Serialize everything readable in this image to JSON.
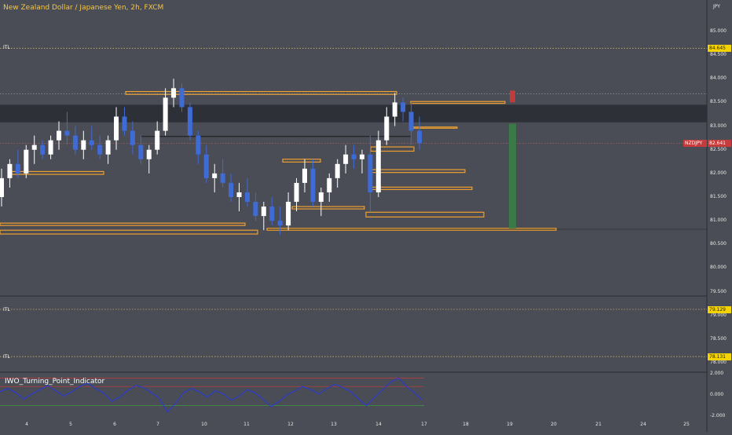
{
  "header": {
    "title": "New Zealand Dollar / Japanese Yen, 2h, FXCM",
    "currency": "JPY",
    "symbol": "NZDJPY"
  },
  "price_axis": {
    "labels": [
      "85.000",
      "84.500",
      "84.000",
      "83.500",
      "83.000",
      "82.500",
      "82.000",
      "81.500",
      "81.000",
      "80.500",
      "80.000",
      "79.500",
      "79.000",
      "78.500",
      "78.000"
    ],
    "current_price": "82.641",
    "itl_levels": [
      {
        "label": "ITL",
        "value": "84.645"
      },
      {
        "label": "ITL",
        "value": "79.129"
      },
      {
        "label": "ITL",
        "value": "78.131"
      }
    ]
  },
  "indicator": {
    "name": "IWO_Turning_Point_Indicator",
    "axis_labels": [
      "2.000",
      "0.000",
      "-2.000"
    ]
  },
  "time_axis": {
    "labels": [
      "4",
      "5",
      "6",
      "7",
      "10",
      "11",
      "12",
      "13",
      "14",
      "17",
      "18",
      "19",
      "20",
      "21",
      "24",
      "25"
    ]
  },
  "colors": {
    "background": "#4a4d55",
    "zone": "#f0a030",
    "up_candle": "#ffffff",
    "down_candle": "#3f6bd6",
    "itl_line": "#d9c36a",
    "sell_marker": "#c23a3a",
    "target_bar": "#3a7a46",
    "band_dark": "#2d3037",
    "osc_line": "#2a3ccc",
    "osc_upper": "#c83a3a",
    "osc_lower": "#3f9a3f"
  },
  "chart_data": {
    "type": "candlestick",
    "title": "New Zealand Dollar / Japanese Yen, 2h, FXCM",
    "ylim": [
      77.9,
      85.3
    ],
    "yticks": [
      85.0,
      84.5,
      84.0,
      83.5,
      83.0,
      82.5,
      82.0,
      81.5,
      81.0,
      80.5,
      80.0,
      79.5,
      79.0,
      78.5,
      78.0
    ],
    "x_labels": [
      "4",
      "5",
      "6",
      "7",
      "10",
      "11",
      "12",
      "13",
      "14",
      "17",
      "18",
      "19",
      "20",
      "21",
      "24",
      "25"
    ],
    "ohlc": [
      [
        81.5,
        82.1,
        81.3,
        81.9
      ],
      [
        81.9,
        82.3,
        81.7,
        82.2
      ],
      [
        82.2,
        82.5,
        81.9,
        82.0
      ],
      [
        82.0,
        82.6,
        81.9,
        82.5
      ],
      [
        82.5,
        82.8,
        82.2,
        82.6
      ],
      [
        82.6,
        82.7,
        82.3,
        82.4
      ],
      [
        82.4,
        82.8,
        82.3,
        82.7
      ],
      [
        82.7,
        83.1,
        82.5,
        82.9
      ],
      [
        82.9,
        83.3,
        82.6,
        82.8
      ],
      [
        82.8,
        83.0,
        82.4,
        82.5
      ],
      [
        82.5,
        82.9,
        82.3,
        82.7
      ],
      [
        82.7,
        83.0,
        82.5,
        82.6
      ],
      [
        82.6,
        82.8,
        82.3,
        82.4
      ],
      [
        82.4,
        82.8,
        82.2,
        82.7
      ],
      [
        82.7,
        83.4,
        82.5,
        83.2
      ],
      [
        83.2,
        83.4,
        82.8,
        82.9
      ],
      [
        82.9,
        83.1,
        82.4,
        82.6
      ],
      [
        82.6,
        82.8,
        82.2,
        82.3
      ],
      [
        82.3,
        82.6,
        82.0,
        82.5
      ],
      [
        82.5,
        83.1,
        82.4,
        82.9
      ],
      [
        82.9,
        83.8,
        82.8,
        83.6
      ],
      [
        83.6,
        84.0,
        83.4,
        83.8
      ],
      [
        83.8,
        83.9,
        83.3,
        83.4
      ],
      [
        83.4,
        83.5,
        82.7,
        82.8
      ],
      [
        82.8,
        82.9,
        82.2,
        82.4
      ],
      [
        82.4,
        82.6,
        81.8,
        81.9
      ],
      [
        81.9,
        82.2,
        81.6,
        82.0
      ],
      [
        82.0,
        82.3,
        81.7,
        81.8
      ],
      [
        81.8,
        82.0,
        81.4,
        81.5
      ],
      [
        81.5,
        81.8,
        81.2,
        81.6
      ],
      [
        81.6,
        81.9,
        81.3,
        81.4
      ],
      [
        81.4,
        81.6,
        81.0,
        81.1
      ],
      [
        81.1,
        81.4,
        80.8,
        81.3
      ],
      [
        81.3,
        81.5,
        80.9,
        81.0
      ],
      [
        81.0,
        81.3,
        80.7,
        80.9
      ],
      [
        80.9,
        81.6,
        80.8,
        81.4
      ],
      [
        81.4,
        81.9,
        81.2,
        81.8
      ],
      [
        81.8,
        82.3,
        81.6,
        82.1
      ],
      [
        82.1,
        82.3,
        81.3,
        81.4
      ],
      [
        81.4,
        81.7,
        81.1,
        81.6
      ],
      [
        81.6,
        82.0,
        81.4,
        81.9
      ],
      [
        81.9,
        82.3,
        81.7,
        82.2
      ],
      [
        82.2,
        82.6,
        82.0,
        82.4
      ],
      [
        82.4,
        82.6,
        82.1,
        82.3
      ],
      [
        82.3,
        82.5,
        82.0,
        82.4
      ],
      [
        82.4,
        82.8,
        81.2,
        81.6
      ],
      [
        81.6,
        82.9,
        81.5,
        82.7
      ],
      [
        82.7,
        83.4,
        82.6,
        83.2
      ],
      [
        83.2,
        83.7,
        83.0,
        83.5
      ],
      [
        83.5,
        83.6,
        83.1,
        83.3
      ],
      [
        83.3,
        83.5,
        82.6,
        82.9
      ],
      [
        82.9,
        83.2,
        82.5,
        82.64
      ]
    ]
  }
}
